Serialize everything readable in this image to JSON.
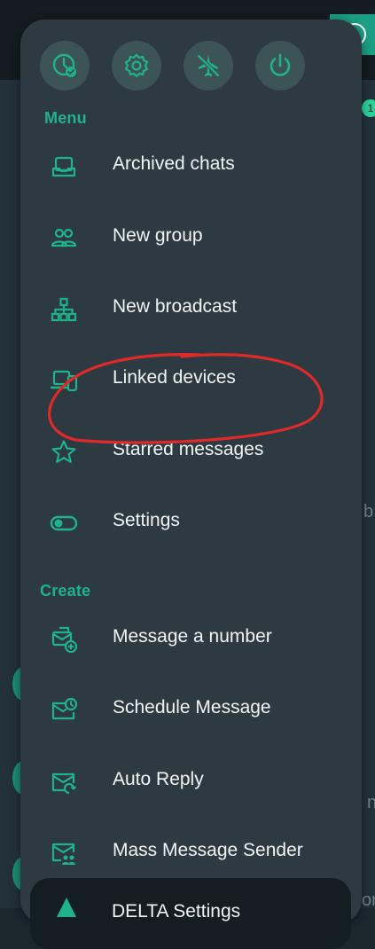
{
  "background": {
    "badge_count": "1",
    "side_chars": [
      "b",
      "n",
      "or"
    ]
  },
  "quick_actions": [
    {
      "name": "status-schedule",
      "icon": "clock-check-icon"
    },
    {
      "name": "badge-settings",
      "icon": "badge-gear-icon"
    },
    {
      "name": "airplane-mode",
      "icon": "airplane-off-icon"
    },
    {
      "name": "power",
      "icon": "power-icon"
    }
  ],
  "menu_section": {
    "label": "Menu",
    "items": [
      {
        "label": "Archived chats",
        "icon": "archive-tray-icon"
      },
      {
        "label": "New group",
        "icon": "group-icon"
      },
      {
        "label": "New broadcast",
        "icon": "broadcast-tree-icon"
      },
      {
        "label": "Linked devices",
        "icon": "devices-icon"
      },
      {
        "label": "Starred messages",
        "icon": "star-icon"
      },
      {
        "label": "Settings",
        "icon": "toggle-icon"
      }
    ]
  },
  "create_section": {
    "label": "Create",
    "items": [
      {
        "label": "Message a number",
        "icon": "message-add-icon"
      },
      {
        "label": "Schedule Message",
        "icon": "mail-clock-icon"
      },
      {
        "label": "Auto Reply",
        "icon": "mail-reply-icon"
      },
      {
        "label": "Mass Message Sender",
        "icon": "mail-group-icon"
      }
    ]
  },
  "bottom_card": {
    "label": "DELTA Settings",
    "icon": "delta-icon"
  },
  "colors": {
    "accent": "#20b389",
    "annotation": "#e02a2a",
    "menu_bg": "#2d3a41",
    "quick_bg": "#3d5456"
  }
}
